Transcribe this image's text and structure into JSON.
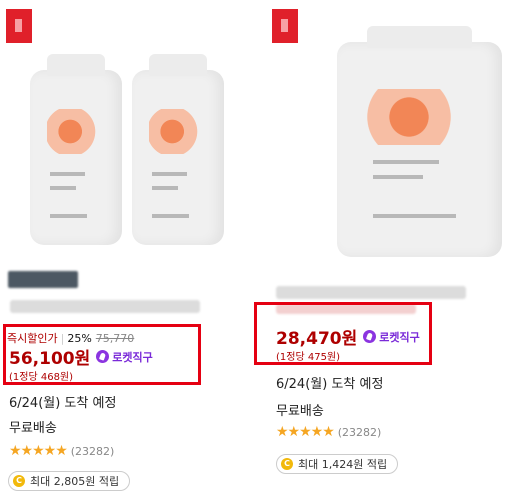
{
  "products": [
    {
      "instant_label": "즉시할인가",
      "discount": "25%",
      "original_price": "75,770",
      "price": "56,100원",
      "rocket_label": "로켓직구",
      "unit_price": "(1정당 468원)",
      "arrival": "6/24(월) 도착 예정",
      "shipping": "무료배송",
      "stars": "★★★★★",
      "review_count": "(23282)",
      "reward": "최대 2,805원 적립"
    },
    {
      "price": "28,470원",
      "rocket_label": "로켓직구",
      "unit_price": "(1정당 475원)",
      "arrival": "6/24(월) 도착 예정",
      "shipping": "무료배송",
      "stars": "★★★★★",
      "review_count": "(23282)",
      "reward": "최대 1,424원 적립"
    }
  ],
  "icons": {
    "coin": "C",
    "rocket": "rocket-icon"
  },
  "colors": {
    "price": "#ae0000",
    "highlight_box": "#e50012",
    "rocket": "#7a2ad8",
    "star": "#f5a623",
    "badge": "#e0202a"
  }
}
